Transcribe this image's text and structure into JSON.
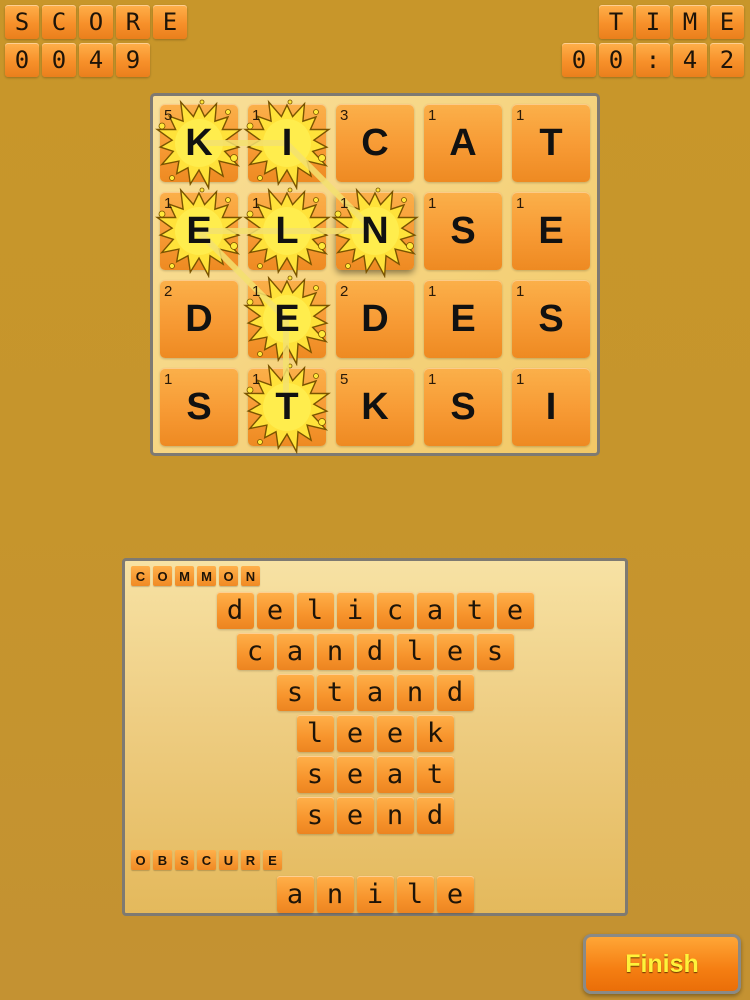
{
  "hud": {
    "score_label": [
      "S",
      "C",
      "O",
      "R",
      "E"
    ],
    "score_value": [
      "0",
      "0",
      "4",
      "9"
    ],
    "time_label": [
      "T",
      "I",
      "M",
      "E"
    ],
    "time_value": [
      "0",
      "0",
      ":",
      "4",
      "2"
    ]
  },
  "board": {
    "rows": [
      [
        {
          "letter": "K",
          "points": "5",
          "splat": true
        },
        {
          "letter": "I",
          "points": "1",
          "splat": true
        },
        {
          "letter": "C",
          "points": "3",
          "splat": false
        },
        {
          "letter": "A",
          "points": "1",
          "splat": false
        },
        {
          "letter": "T",
          "points": "1",
          "splat": false
        }
      ],
      [
        {
          "letter": "E",
          "points": "1",
          "splat": true
        },
        {
          "letter": "L",
          "points": "1",
          "splat": true
        },
        {
          "letter": "N",
          "points": "1",
          "splat": true,
          "raised": true
        },
        {
          "letter": "S",
          "points": "1",
          "splat": false
        },
        {
          "letter": "E",
          "points": "1",
          "splat": false
        }
      ],
      [
        {
          "letter": "D",
          "points": "2",
          "splat": false
        },
        {
          "letter": "E",
          "points": "1",
          "splat": true
        },
        {
          "letter": "D",
          "points": "2",
          "splat": false
        },
        {
          "letter": "E",
          "points": "1",
          "splat": false
        },
        {
          "letter": "S",
          "points": "1",
          "splat": false
        }
      ],
      [
        {
          "letter": "S",
          "points": "1",
          "splat": false
        },
        {
          "letter": "T",
          "points": "1",
          "splat": true
        },
        {
          "letter": "K",
          "points": "5",
          "splat": false
        },
        {
          "letter": "S",
          "points": "1",
          "splat": false
        },
        {
          "letter": "I",
          "points": "1",
          "splat": false
        }
      ]
    ]
  },
  "words": {
    "common_label": [
      "C",
      "O",
      "M",
      "M",
      "O",
      "N"
    ],
    "common": [
      "delicate",
      "candles",
      "stand",
      "leek",
      "seat",
      "send"
    ],
    "obscure_label": [
      "O",
      "B",
      "S",
      "C",
      "U",
      "R",
      "E"
    ],
    "obscure": [
      "anile"
    ]
  },
  "finish_label": "Finish"
}
